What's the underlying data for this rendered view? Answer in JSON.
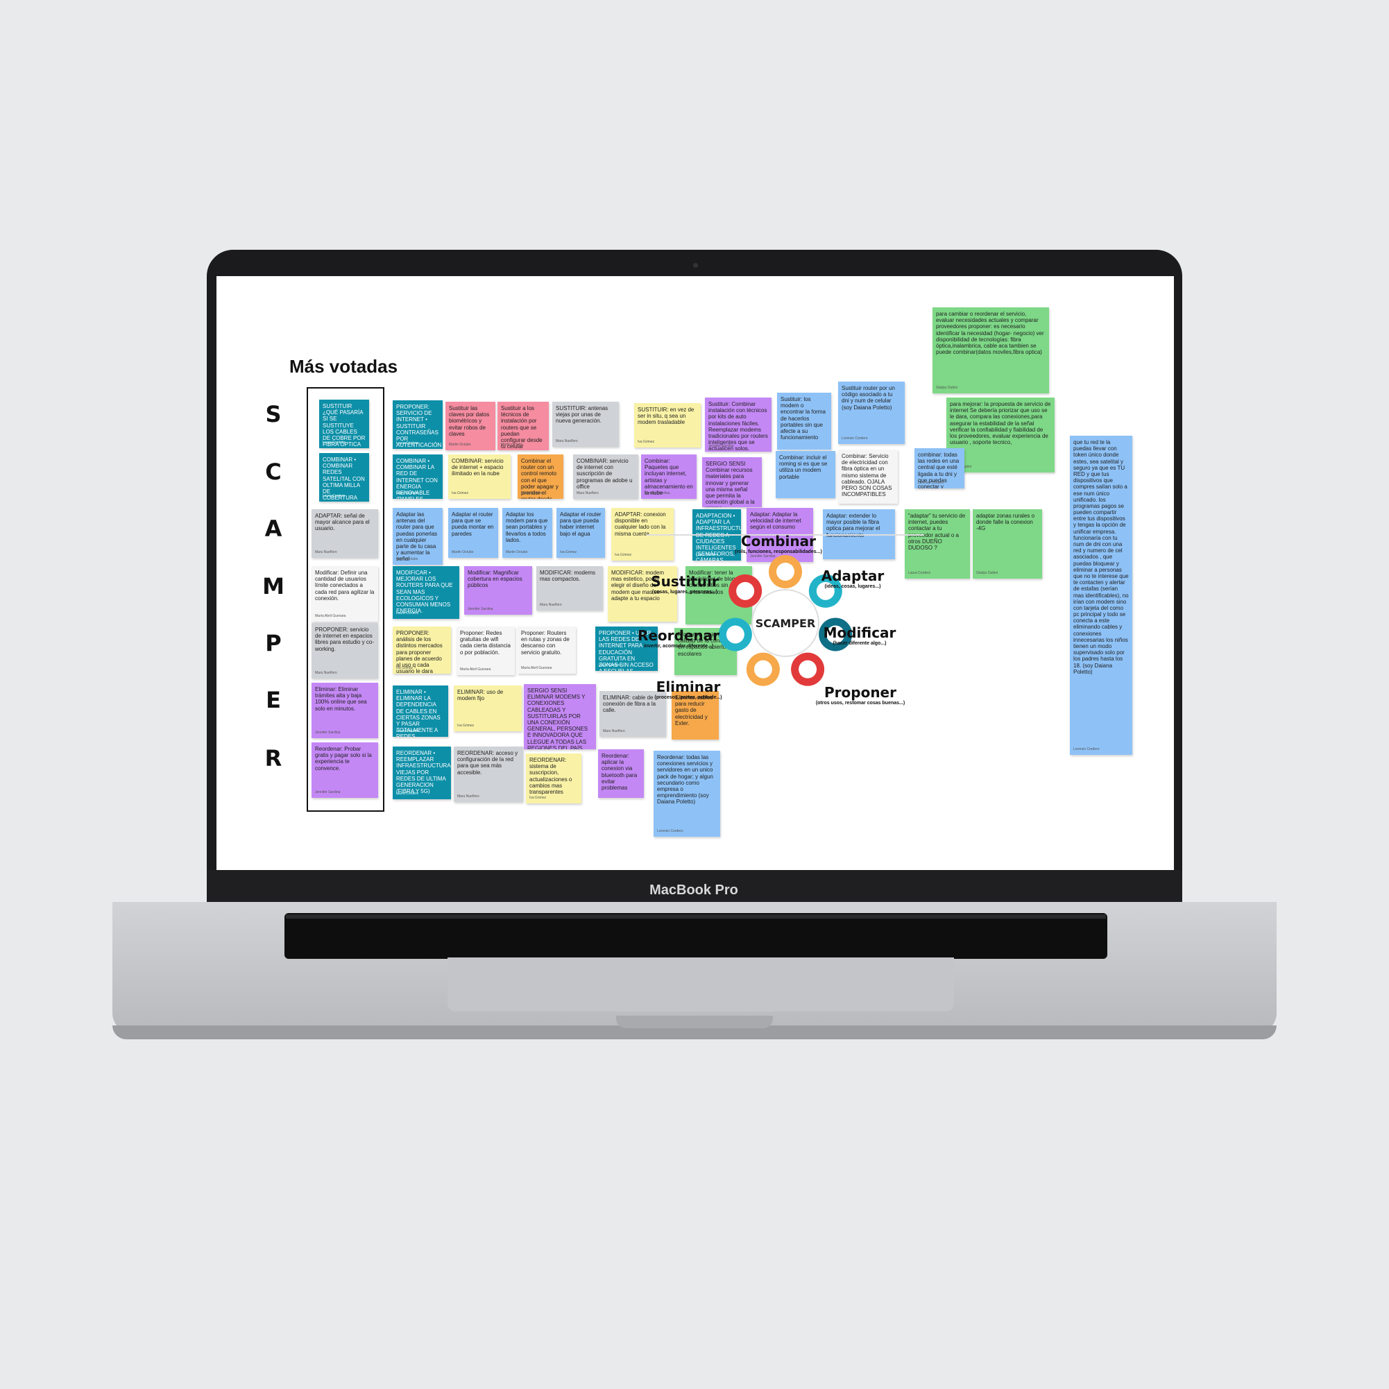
{
  "device": {
    "brand_label": "MacBook Pro"
  },
  "board": {
    "title": "Más votadas",
    "letters": [
      "S",
      "C",
      "A",
      "M",
      "P",
      "E",
      "R"
    ],
    "notes": [
      {
        "text": "SUSTITUIR ¿QUÉ PASARÍA SI SE SUSTITUYE LOS CABLES DE COBRE POR FIBRA ÓPTICA EN TODAS LAS REDES?",
        "author": "Laura Cordero",
        "color": "teal"
      },
      {
        "text": "COMBINAR • COMBINAR REDES SATELITAL CON OLTIMA MILLA DE COBERTURA EN ZONAS RURALES",
        "author": "Laura Cordero",
        "color": "teal"
      },
      {
        "text": "ADAPTAR: señal de mayor alcance para el usuario.",
        "author": "Maru Nuefloro",
        "color": "gray"
      },
      {
        "text": "Modificar: Definir una cantidad de usuarios límite conectados a cada red para agilizar la conexión.",
        "author": "María Abril Guevara",
        "color": "white"
      },
      {
        "text": "PROPONER: servicio de internet en espacios libres para estudio y co-working.",
        "author": "Maru Nuefloro",
        "color": "gray"
      },
      {
        "text": "Eliminar: Eliminar trámites alta y baja 100% online que sea solo en minutos.",
        "author": "Jennifer Sardina",
        "color": "purple"
      },
      {
        "text": "Reordenar: Probar gratis y pagar solo si la experiencia te convence.",
        "author": "Jennifer Sardina",
        "color": "purple"
      },
      {
        "text": "PROPONER: SERVICIO DE INTERNET • SUSTITUIR CONTRASEÑAS POR AUTENTICACIÓN BIOMETRICA PARA MAYOR SEGURIDAD.",
        "author": "Laura Cordero",
        "color": "teal"
      },
      {
        "text": "Sustituir las claves por datos biométricos y evitar robos de claves",
        "author": "Martin Octubo",
        "color": "pink"
      },
      {
        "text": "Sustituir a los técnicos de instalación por routers que se puedan configurar desde tu celular",
        "author": "Martin Octubo",
        "color": "pink"
      },
      {
        "text": "SUSTITUIR: antenas viejas por unas de nueva generación.",
        "author": "Maru Nuefloro",
        "color": "gray"
      },
      {
        "text": "SUSTITUIR: en vez de ser in situ, q sea un modem trasladable",
        "author": "Iva Gómez",
        "color": "yellow"
      },
      {
        "text": "Sustituir: Combinar instalación con técnicos por kits de auto instalaciones fáciles. Reemplazar modems tradicionales por routers inteligentes que se actualicen solos.",
        "author": "Jennifer Sardina",
        "color": "purple"
      },
      {
        "text": "Sustituir: los modem o encontrar la forma de hacerlos portables sin que afecte a su funcionamiento",
        "author": "",
        "color": "blue"
      },
      {
        "text": "Sustituir router por un código asociado a tu dni y num de celular (soy Daiana Poletto)",
        "author": "Lorenzo Cordero",
        "color": "blue"
      },
      {
        "text": "para cambiar o reordenar el servicio, evaluar necesidades actuales y comparar proveedores proponer: es necesario identificar la necesidad (hogar- negocio) ver disponibilidad de tecnologías: fibra óptica,inalambrica, cable aca tambien se puede combinar(datos moviles,fibra optica)",
        "author": "Gladys Dubini",
        "color": "green"
      },
      {
        "text": "para mejorar: la propuesta de servicio de internet Se debería priorizar que uso se le dara, compara las conexiones,para asegurar la estabilidad de la señal verificar la confiabilidad y fiabilidad de los proveedores, evaluar experiencia de usuario , soporte tecnico,",
        "author": "Gladys Dubini",
        "color": "green"
      },
      {
        "text": "COMBINAR • COMBINAR LA RED DE INTERNET CON ENERGIA RENOVABLE (PANELES SOLARES)",
        "author": "Laura Cordero",
        "color": "teal"
      },
      {
        "text": "COMBINAR: servicio de internet + espacio ilimitado en la nube",
        "author": "Iva Gómez",
        "color": "yellow"
      },
      {
        "text": "Combinar el router con un control remoto con el que poder apagar y prender el router desde lejos",
        "author": "Martin Octubo",
        "color": "orange"
      },
      {
        "text": "COMBINAR: servicio de internet con suscripción de programas de adobe u office",
        "author": "Maru Nuefloro",
        "color": "gray"
      },
      {
        "text": "Combinar: Paquetes que incluyan internet, artistas y almacenamiento en la nube",
        "author": "Jennifer Sardina",
        "color": "purple"
      },
      {
        "text": "SERGIO SENSI Combinar recursos materiales para innovar y generar una misma señal que permita la conexión global a la misma.",
        "author": "",
        "color": "purple"
      },
      {
        "text": "Combinar: incluir el roming si es que se utiliza un modem portable",
        "author": "",
        "color": "blue"
      },
      {
        "text": "Combinar: Servicio de electricidad con fibra óptica en un mismo sistema de cableado. OJALA PERO SON COSAS INCOMPATIBLES",
        "author": "",
        "color": "white"
      },
      {
        "text": "combinar: todas las redes en una central que esté ligada a tu dni y que puedas conectar y llevarte a todos lados (soy Daiana Poletto)",
        "author": "Lorenzo Cordero",
        "color": "blue"
      },
      {
        "text": "que tu red te la puedas llevar con token único donde estes, sea satelital y seguro ya que es TU RED y que tus dispositivos que compres salían solo a ese num único unificado. los programas pagos se pueden compartir entre tus dispositivos y tengas la opción de unificar empresa. funcionaría con tu num de dni con una red y numero de cel asociados , que puedas bloquear y eliminar a personas que no te interese que te contacten y alertar de estafas (serían mas identificables), no irían con modem sino con tarjeta del como pc principal y todo se conecta a este eliminando cables y conexiones innecesarias los niños tienen un modo supervisado solo por los padres hasta los 18. (soy Daiana Poletto)",
        "author": "Lorenzo Cordero",
        "color": "blue"
      },
      {
        "text": "Adaptar las antenas del router para que puedas ponerlas en cualquier parte de tu casa y aumentar la señal",
        "author": "Martin Octubo",
        "color": "blue"
      },
      {
        "text": "Adaptar el router para que se pueda montar en paredes",
        "author": "Martin Octubo",
        "color": "blue"
      },
      {
        "text": "Adaptar los modem para que sean portables y llevarlos a todos lados.",
        "author": "Martin Octubo",
        "color": "blue"
      },
      {
        "text": "Adaptar el router para que pueda haber internet bajo el agua",
        "author": "Iva Gómez",
        "color": "blue"
      },
      {
        "text": "ADAPTAR: conexion disponible en cualquier lado con la misma cuenta",
        "author": "Iva Gómez",
        "color": "yellow"
      },
      {
        "text": "ADAPTACION • ADAPTAR LA INFRAESTRUCTURA DE REDES A CIUDADES INTELIGENTES (SEMÁFOROS, CÁMARAS, SENSORES)",
        "author": "Laura Cordero",
        "color": "teal"
      },
      {
        "text": "Adaptar: Adaptar la velocidad de internet según el consumo",
        "author": "Jennifer Sardina",
        "color": "purple"
      },
      {
        "text": "Adaptar: extender lo mayor posible la fibra optica para mejorar el funcionamiento",
        "author": "",
        "color": "blue"
      },
      {
        "text": "\"adaptar\" tu servicio de internet, puedes contactar a tu proveedor actual o a otros DUEÑO DUDOSO ?",
        "author": "Laura Cordero",
        "color": "green"
      },
      {
        "text": "adaptar zonas rurales o donde falle la conexion -4G",
        "author": "Gladys Dubini",
        "color": "green"
      },
      {
        "text": "MODIFICAR • MEJORAR LOS ROUTERS PARA QUE SEAN MAS ECOLOGICOS Y CONSUMAN MENOS ENERGIA.",
        "author": "Laura Cordero",
        "color": "teal"
      },
      {
        "text": "Modificar: Magnificar cobertura en espacios públicos",
        "author": "Jennifer Sardina",
        "color": "purple"
      },
      {
        "text": "MODIFICAR: modems mas compactos.",
        "author": "Maru Nuefloro",
        "color": "gray"
      },
      {
        "text": "MODIFICAR: modem mas estetico, poder elegir el diseño de modem que mas se adapte a tu espacio",
        "author": "",
        "color": "yellow"
      },
      {
        "text": "Modificar: tener la posibilidad de bloquear ciertos sitios sin avisar a los usuarios",
        "author": "",
        "color": "green"
      },
      {
        "text": "PROPONER: análisis de los distintos mercados para proponer planes de acuerdo al uso q cada usuario le dara",
        "author": "Iva Gómez",
        "color": "yellow"
      },
      {
        "text": "Proponer: Redes gratuitas de wifi cada cierta distancia o por población.",
        "author": "María Abril Guevara",
        "color": "white"
      },
      {
        "text": "Proponer: Routers en rutas y zonas de descanso con servicio gratuito.",
        "author": "María Abril Guevara",
        "color": "white"
      },
      {
        "text": "PROPONER • USAR LAS REDES DE INTERNET PARA EDUCACIÓN GRATUITA EN ZONAS SIN ACCESO A ESCUELAS.",
        "author": "Laura Cordero",
        "color": "teal"
      },
      {
        "text": "Proponer: mejorar la calidad de la conexion en espacios abiertos y escolares",
        "author": "",
        "color": "green"
      },
      {
        "text": "ELIMINAR • ELIMINAR LA DEPENDENCIA DE CABLES EN CIERTAS ZONAS Y PASAR TOTALMENTE A REDES INALÁMBRICAS.",
        "author": "Laura Cordero",
        "color": "teal"
      },
      {
        "text": "ELIMINAR: uso de modem fijo",
        "author": "Iva Gómez",
        "color": "yellow"
      },
      {
        "text": "SERGIO SENSI ELIMINAR MODEMS Y CONEXIONES CABLEADAS Y SUSTITUIRLAS POR UNA CONEXIÓN GENERAL, PERSONES E INNOVADORA QUE LLEGUE A TODAS LAS REGIONES DEL PAÍS.",
        "author": "",
        "color": "purple"
      },
      {
        "text": "ELIMINAR: cable de conexión de fibra a la calle.",
        "author": "Maru Nuefloro",
        "color": "gray"
      },
      {
        "text": "Eliminar cables para reducir gasto de electricidad y Exter.",
        "author": "",
        "color": "orange"
      },
      {
        "text": "REORDENAR • REEMPLAZAR INFRAESTRUCTURAS VIEJAS POR REDES DE ULTIMA GENERACION (FIBRA Y 5G)",
        "author": "Laura Cordero",
        "color": "teal"
      },
      {
        "text": "REORDENAR: acceso y configuración de la red para que sea más accesible.",
        "author": "Maru Nuefloro",
        "color": "gray"
      },
      {
        "text": "REORDENAR: sistema de suscripcion, actualizaciones o cambios mas transparentes",
        "author": "Iva Gómez",
        "color": "yellow"
      },
      {
        "text": "Reordenar: aplicar la conexion via bluetooth para evitar problemas",
        "author": "",
        "color": "purple"
      },
      {
        "text": "Reordenar: todas las conexiones servicios y servidores en un unico pack de hogar; y algun secundario como empresa o emprendimiento (soy Daiana Poletto)",
        "author": "Lorenzo Cordero",
        "color": "blue"
      }
    ],
    "diagram": {
      "center": "SCAMPER",
      "items": [
        {
          "title": "Combinar",
          "sub": "(rols, funciones, responsabilidades...)",
          "color": "#f6a84a"
        },
        {
          "title": "Adaptar",
          "sub": "(ideas, cosas, lugares...)",
          "color": "#22b3c9"
        },
        {
          "title": "Modificar",
          "sub": "(hacer diferente algo...)",
          "color": "#0e6f86"
        },
        {
          "title": "Proponer",
          "sub": "(otros usos, restomar cosas buenas...)",
          "color": "#e23a3a"
        },
        {
          "title": "Eliminar",
          "sub": "(procesos, partes, actitude...)",
          "color": "#f6a84a"
        },
        {
          "title": "Reordenar",
          "sub": "invertir, acomodar diferente...)",
          "color": "#22b3c9"
        },
        {
          "title": "Sustituir",
          "sub": "(cosas, lugares, personas...)",
          "color": "#e23a3a"
        }
      ]
    }
  }
}
